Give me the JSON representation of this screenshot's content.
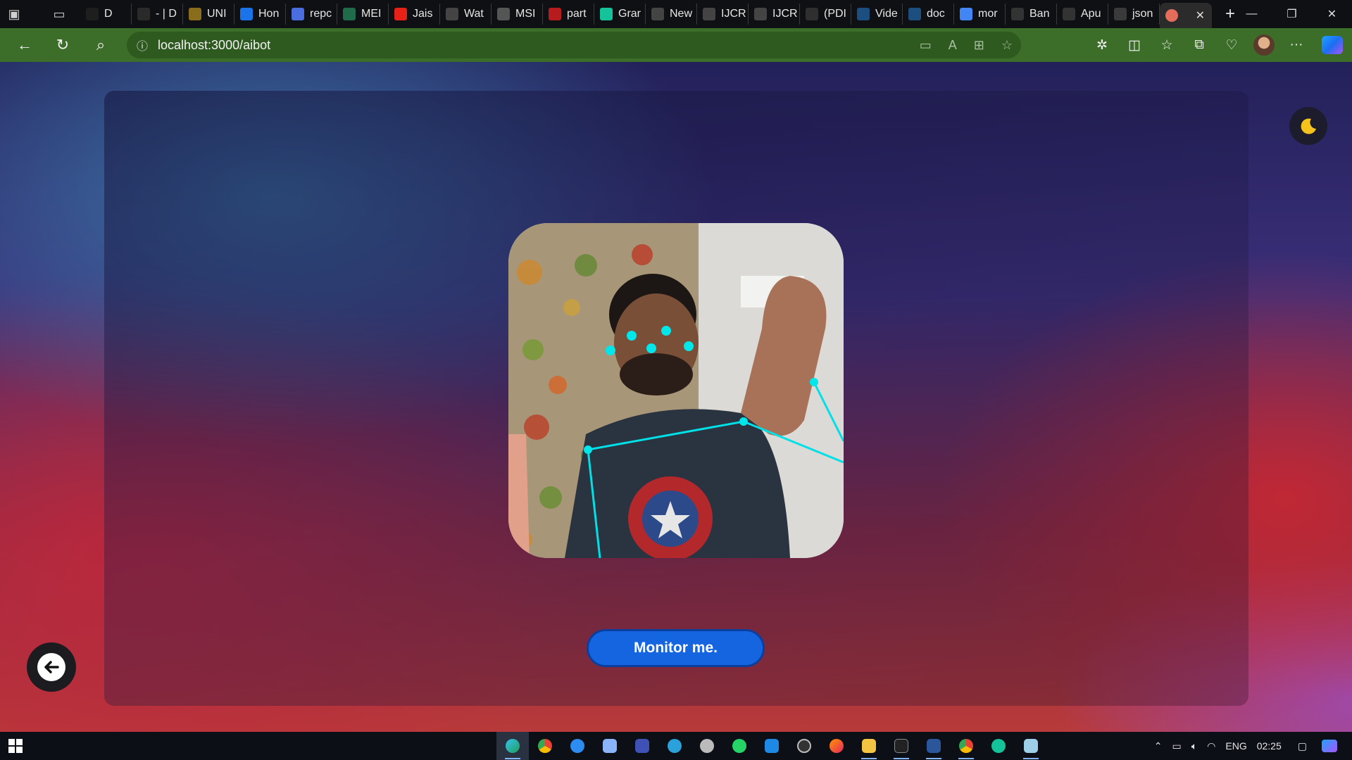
{
  "browser": {
    "tabs": [
      {
        "label": "D",
        "icon": "devto-icon",
        "color": "#1e1e1e"
      },
      {
        "label": "- | D",
        "icon": "dev-icon",
        "color": "#2a2a2a"
      },
      {
        "label": "UNI",
        "icon": "folder-icon",
        "color": "#8a6d1c"
      },
      {
        "label": "Hon",
        "icon": "google-drive-icon",
        "color": "#1a73e8"
      },
      {
        "label": "repc",
        "icon": "docs-icon",
        "color": "#4a6ee0"
      },
      {
        "label": "MEI",
        "icon": "mei-icon",
        "color": "#1f6b4a"
      },
      {
        "label": "Jais",
        "icon": "youtube-icon",
        "color": "#e62117"
      },
      {
        "label": "Wat",
        "icon": "amazon-icon",
        "color": "#444444"
      },
      {
        "label": "MSI",
        "icon": "msi-icon",
        "color": "#555555"
      },
      {
        "label": "part",
        "icon": "pdf-icon",
        "color": "#b71c1c"
      },
      {
        "label": "Grar",
        "icon": "grammarly-icon",
        "color": "#15c39a"
      },
      {
        "label": "New",
        "icon": "page-icon",
        "color": "#444444"
      },
      {
        "label": "IJCR",
        "icon": "document-icon",
        "color": "#444444"
      },
      {
        "label": "IJCR",
        "icon": "document-icon",
        "color": "#444444"
      },
      {
        "label": "(PDI",
        "icon": "researchgate-icon",
        "color": "#2f2f2f"
      },
      {
        "label": "Vide",
        "icon": "video-icon",
        "color": "#1c4e80"
      },
      {
        "label": "doc",
        "icon": "doc-icon",
        "color": "#1c4e80"
      },
      {
        "label": "mor",
        "icon": "google-icon",
        "color": "#4285f4"
      },
      {
        "label": "Ban",
        "icon": "github-icon",
        "color": "#333333"
      },
      {
        "label": "Apu",
        "icon": "github-icon",
        "color": "#333333"
      },
      {
        "label": "json",
        "icon": "json-icon",
        "color": "#3a3a3a"
      }
    ],
    "active_tab_icon_color": "#e46c5a",
    "new_tab_label": "+",
    "url": "localhost:3000/aibot",
    "accent_color": "#3c6e2a"
  },
  "page": {
    "monitor_button_label": "Monitor me.",
    "button_color": "#1565e0"
  },
  "taskbar": {
    "language": "ENG",
    "time": "02:25"
  }
}
